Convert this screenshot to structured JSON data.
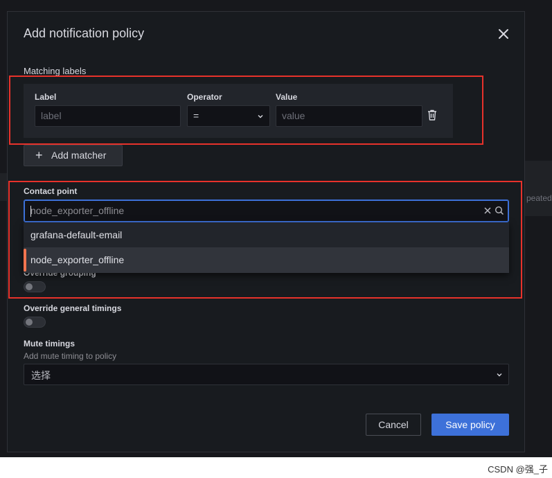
{
  "modal": {
    "title": "Add notification policy"
  },
  "matching_labels": {
    "heading": "Matching labels",
    "columns": {
      "label": "Label",
      "operator": "Operator",
      "value": "Value"
    },
    "row": {
      "label_placeholder": "label",
      "operator_value": "=",
      "value_placeholder": "value"
    },
    "add_button": "Add matcher"
  },
  "contact_point": {
    "heading": "Contact point",
    "input_value": "node_exporter_offline",
    "options": [
      {
        "label": "grafana-default-email",
        "selected": false
      },
      {
        "label": "node_exporter_offline",
        "selected": true
      }
    ]
  },
  "override_grouping": {
    "label": "Override grouping",
    "enabled": false
  },
  "override_timings": {
    "label": "Override general timings",
    "enabled": false
  },
  "mute_timings": {
    "heading": "Mute timings",
    "description": "Add mute timing to policy",
    "placeholder": "选择"
  },
  "footer": {
    "cancel": "Cancel",
    "save": "Save policy"
  },
  "background": {
    "fragment": "peated"
  },
  "watermark": "CSDN @强_子",
  "colors": {
    "accent": "#3d71d9",
    "selected_bar": "#f2744f",
    "annotation_red": "#e8322b"
  }
}
